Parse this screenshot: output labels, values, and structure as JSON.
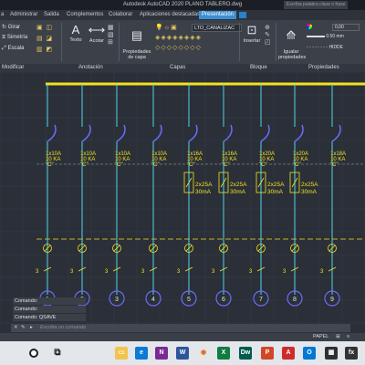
{
  "window": {
    "title": "Autodesk AutoCAD 2020   PLANO TABLERO.dwg",
    "search_placeholder": "Escriba palabra clave o frase"
  },
  "menu_tabs": [
    {
      "label": "a"
    },
    {
      "label": "Administrar"
    },
    {
      "label": "Salida"
    },
    {
      "label": "Complementos"
    },
    {
      "label": "Colaborar"
    },
    {
      "label": "Aplicaciones destacadas"
    },
    {
      "label": "Presentación",
      "active": true
    }
  ],
  "ribbon": {
    "modify_tools": [
      "Girar",
      "Simetría",
      "Escala"
    ],
    "texto": "Texto",
    "acotar": "Acotar",
    "propiedades_capa": "Propiedades\nde capa",
    "layer_name": "LTO_CANALIZAC",
    "insertar": "Insertar",
    "igualar_propiedades": "Igualar\npropiedades",
    "color_value": "0,00",
    "lineweight": "0.50 mm",
    "linetype": "HIDDE"
  },
  "panels": [
    "Modificar",
    "Anotación",
    "Capas",
    "Bloque",
    "Propiedades"
  ],
  "breakers": [
    {
      "label": "1x10A\n10 KA\n\"C\""
    },
    {
      "label": "1x10A\n10 KA\n\"C\""
    },
    {
      "label": "1x10A\n10 KA\n\"C\""
    },
    {
      "label": "1x10A\n10 KA\n\"C\""
    },
    {
      "label": "1x16A\n10 KA\n\"C\""
    },
    {
      "label": "1x16A\n10 KA\n\"C\""
    },
    {
      "label": "1x20A\n10 KA\n\"C\""
    },
    {
      "label": "1x20A\n10 KA\n\"C\""
    },
    {
      "label": "1x18A\n10 KA\n\"C\""
    }
  ],
  "differentials": [
    "2x25A\n30mA",
    "2x25A\n30mA",
    "2x25A\n30mA",
    "2x25A\n30mA"
  ],
  "circuits": [
    "1",
    "2",
    "3",
    "4",
    "5",
    "6",
    "7",
    "8",
    "9"
  ],
  "wire_label": "3",
  "command_history": [
    "Comando:",
    "Comando:",
    "Comando:  QSAVE"
  ],
  "command_placeholder": "Escriba un comando",
  "status": {
    "papel": "PAPEL"
  },
  "colors": {
    "yellow": "#f2e21f",
    "cyan": "#4fd6e8",
    "blue": "#6b6cf7",
    "grid": "#3a3f4a"
  }
}
